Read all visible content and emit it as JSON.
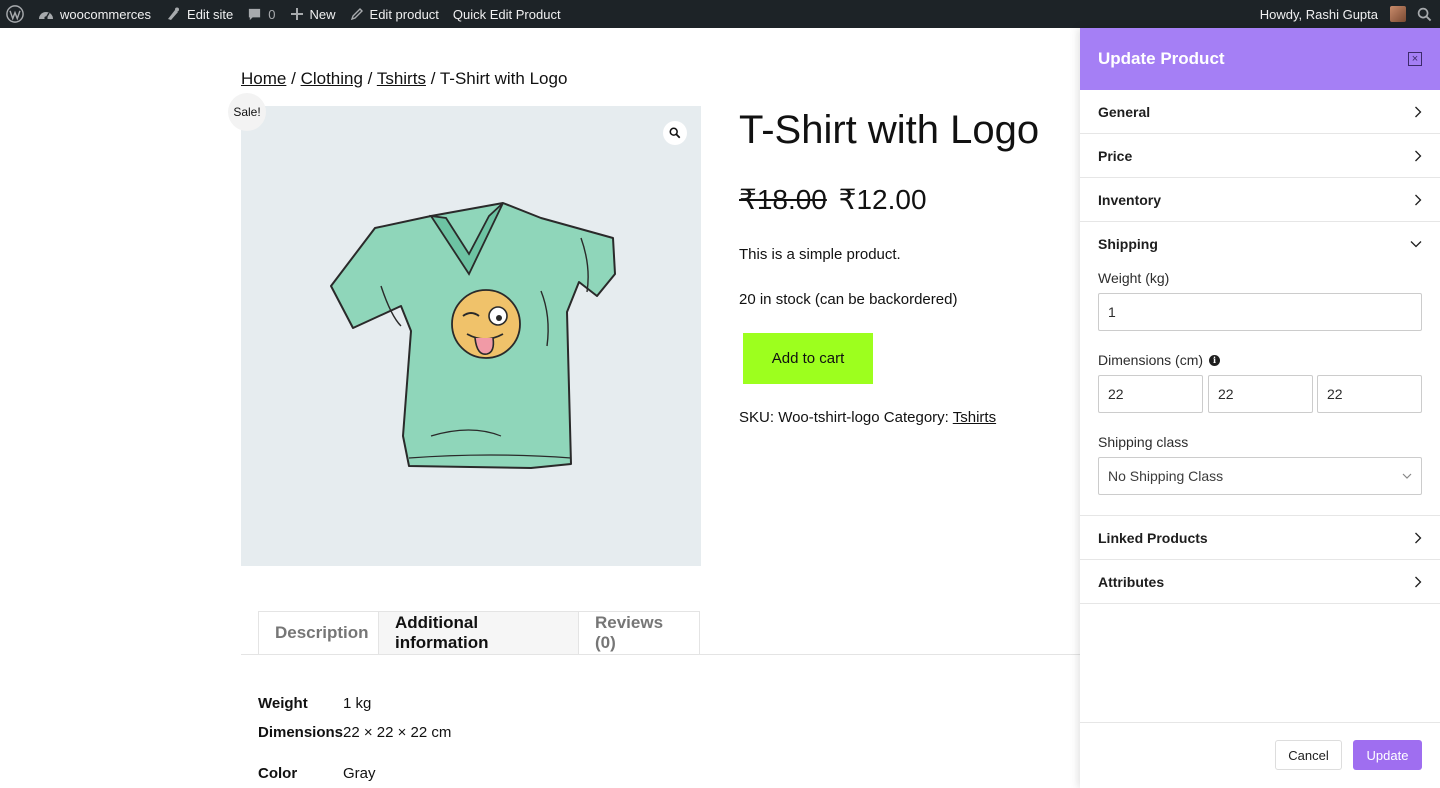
{
  "admin_bar": {
    "site_name": "woocommerces",
    "edit_site": "Edit site",
    "comments_count": "0",
    "new": "New",
    "edit_product": "Edit product",
    "quick_edit": "Quick Edit Product",
    "greeting": "Howdy, Rashi Gupta"
  },
  "breadcrumb": {
    "items": [
      "Home",
      "Clothing",
      "Tshirts"
    ],
    "separator": "/",
    "current": "T-Shirt with Logo"
  },
  "product": {
    "sale_badge": "Sale!",
    "title": "T-Shirt with Logo",
    "old_price": "₹18.00",
    "price": "₹12.00",
    "short_description": "This is a simple product.",
    "stock": "20 in stock (can be backordered)",
    "add_to_cart": "Add to cart",
    "sku_label": "SKU:",
    "sku": "Woo-tshirt-logo",
    "category_label": "Category:",
    "category": "Tshirts"
  },
  "tabs": [
    {
      "label": "Description"
    },
    {
      "label": "Additional information",
      "active": true
    },
    {
      "label": "Reviews (0)"
    }
  ],
  "attributes": [
    {
      "key": "Weight",
      "value": "1 kg"
    },
    {
      "key": "Dimensions",
      "value": "22 × 22 × 22 cm"
    },
    {
      "key": "Color",
      "value": "Gray"
    }
  ],
  "panel": {
    "title": "Update Product",
    "close_label": "×",
    "sections": {
      "general": "General",
      "price": "Price",
      "inventory": "Inventory",
      "shipping": "Shipping",
      "linked": "Linked Products",
      "attributes": "Attributes"
    },
    "shipping": {
      "weight_label": "Weight (kg)",
      "weight_value": "1",
      "dimensions_label": "Dimensions (cm)",
      "length": "22",
      "width": "22",
      "height": "22",
      "class_label": "Shipping class",
      "class_value": "No Shipping Class"
    },
    "cancel": "Cancel",
    "update": "Update"
  },
  "colors": {
    "admin_bar": "#1d2327",
    "panel_header": "#a57ff5",
    "update_button": "#9f6ef0",
    "add_to_cart": "#9dff1e"
  }
}
